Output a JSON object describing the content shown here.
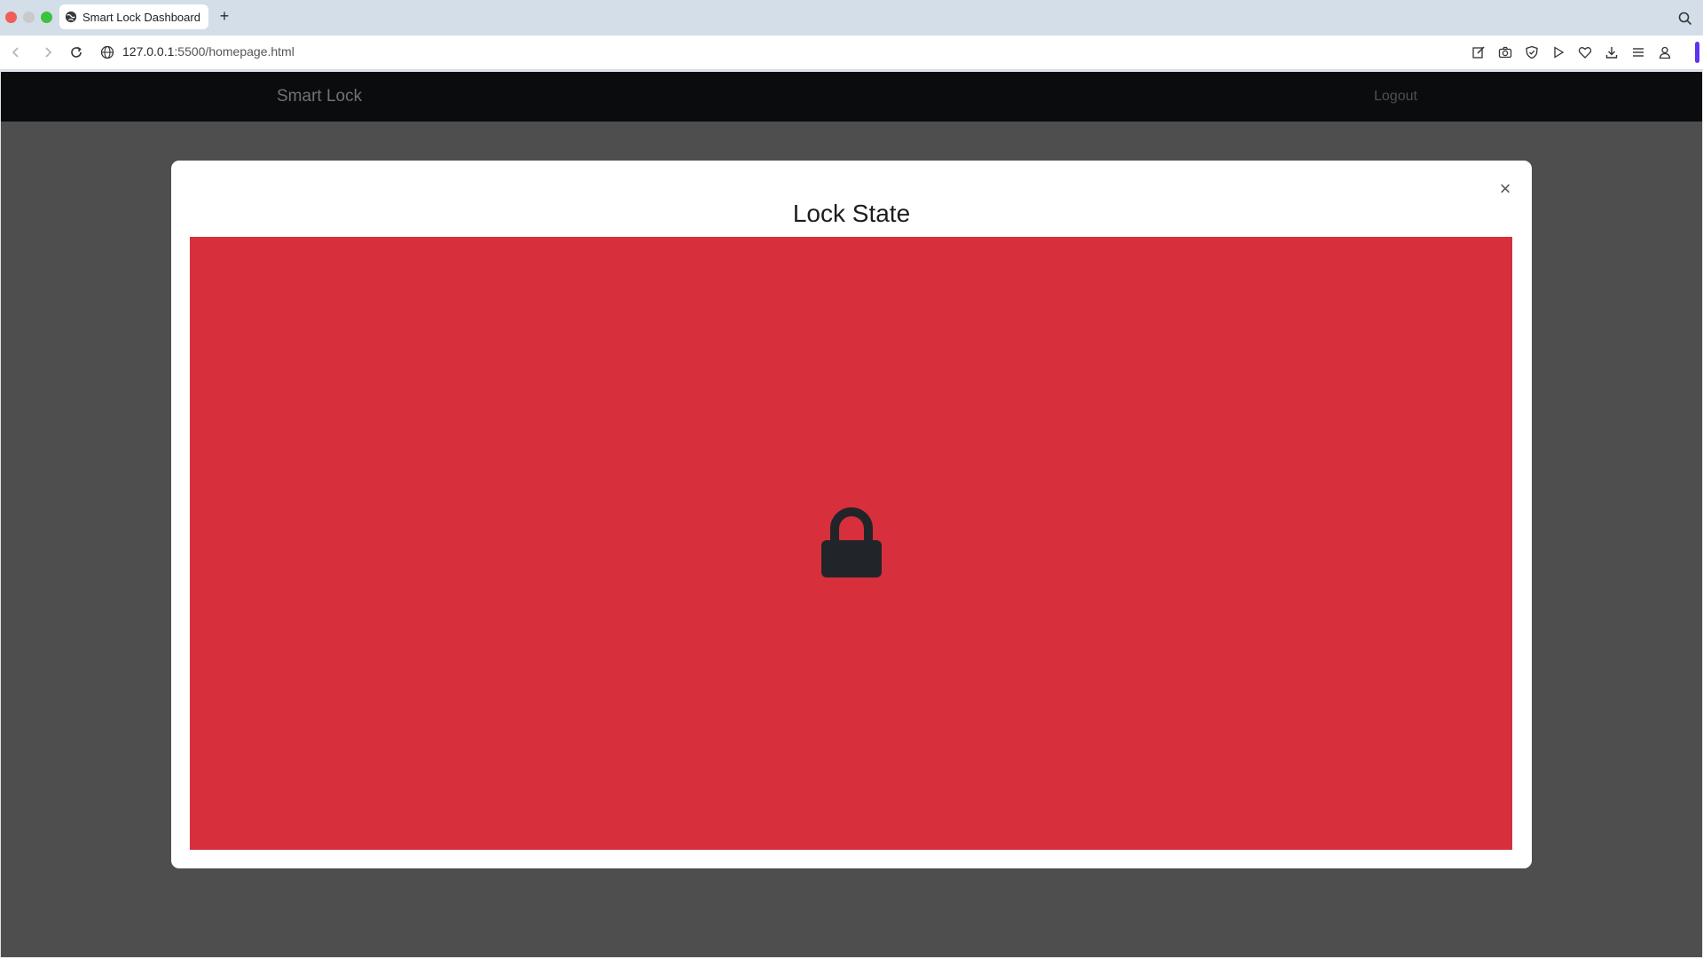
{
  "browser": {
    "tab_title": "Smart Lock Dashboard",
    "new_tab_label": "+",
    "url_host": "127.0.0.1",
    "url_rest": ":5500/homepage.html"
  },
  "navbar": {
    "brand": "Smart Lock",
    "logout": "Logout"
  },
  "modal": {
    "title": "Lock State",
    "close_label": "×",
    "state_color": "#d72f3c",
    "icon": "lock-icon"
  }
}
